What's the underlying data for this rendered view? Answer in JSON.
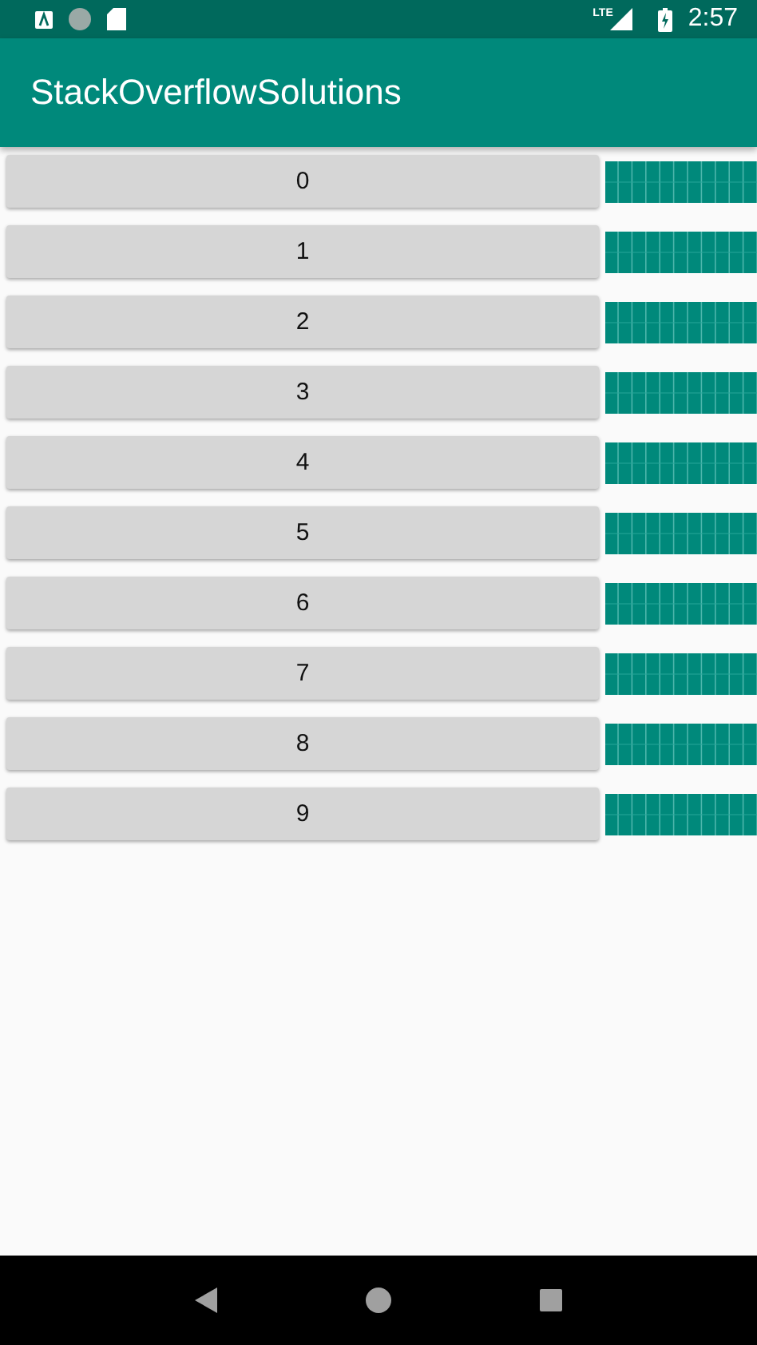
{
  "status_bar": {
    "time": "2:57",
    "network": "LTE"
  },
  "app_bar": {
    "title": "StackOverflowSolutions"
  },
  "rows": [
    {
      "label": "0"
    },
    {
      "label": "1"
    },
    {
      "label": "2"
    },
    {
      "label": "3"
    },
    {
      "label": "4"
    },
    {
      "label": "5"
    },
    {
      "label": "6"
    },
    {
      "label": "7"
    },
    {
      "label": "8"
    },
    {
      "label": "9"
    }
  ]
}
